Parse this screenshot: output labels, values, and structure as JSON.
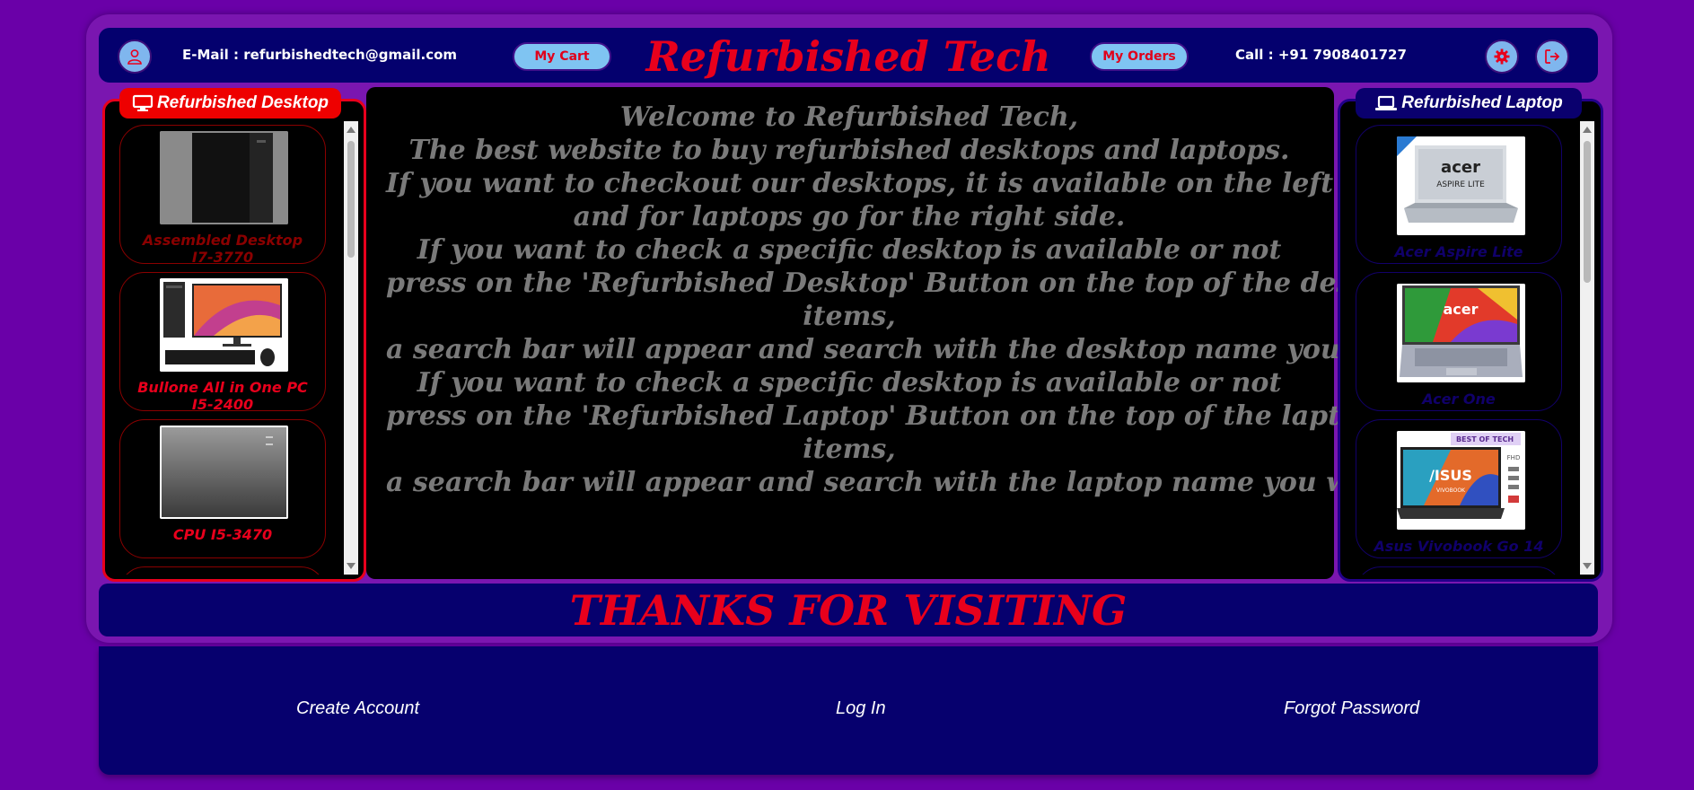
{
  "header": {
    "email_label": "E-Mail : refurbishedtech@gmail.com",
    "cart_button": "My Cart",
    "title": "Refurbished Tech",
    "orders_button": "My Orders",
    "call_label": "Call : +91 7908401727"
  },
  "left_panel": {
    "tab_label": "Refurbished Desktop",
    "items": [
      {
        "name_line1": "Assembled Desktop",
        "name_line2": "I7-3770",
        "color": "#8a0000"
      },
      {
        "name_line1": "Bullone All in One PC",
        "name_line2": "I5-2400",
        "color": "#e8001c"
      },
      {
        "name_line1": "CPU I5-3470",
        "name_line2": "",
        "color": "#e8001c"
      }
    ]
  },
  "right_panel": {
    "tab_label": "Refurbished Laptop",
    "items": [
      {
        "name": "Acer Aspire Lite",
        "image_text": "acer",
        "image_subtext": "ASPIRE LITE"
      },
      {
        "name": "Acer One",
        "image_text": "acer",
        "image_subtext": ""
      },
      {
        "name": "Asus Vivobook Go 14",
        "image_text": "/ISUS",
        "image_subtext": "VIVOBOOK",
        "badge": "BEST OF TECH",
        "side_text": "FHD"
      }
    ]
  },
  "welcome": {
    "lines": [
      "Welcome to Refurbished Tech,",
      "The best website to buy refurbished desktops and laptops.",
      "If you want to checkout our desktops, it is available on the left side",
      "and for laptops go for the right side.",
      "If you want to check a specific desktop is available or not",
      "press on the 'Refurbished Desktop' Button on the top of the desktop",
      "items,",
      "a search bar will appear and search with the desktop name you want.",
      "If you want to check a specific desktop is available or not",
      "press on the 'Refurbished Laptop' Button on the top of the laptop",
      "items,",
      "a search bar will appear and search with the laptop name you want."
    ]
  },
  "banner": {
    "text": "THANKS FOR VISITING"
  },
  "footer": {
    "create_account": "Create Account",
    "log_in": "Log In",
    "forgot_password": "Forgot Password"
  },
  "colors": {
    "background": "#6a00a8",
    "navy": "#06006e",
    "accent_red": "#e8001c",
    "button_blue": "#7fc4f2",
    "welcome_text": "#7a7a7a"
  },
  "icons": [
    "user-icon",
    "gear-icon",
    "logout-icon",
    "desktop-icon",
    "laptop-icon"
  ]
}
